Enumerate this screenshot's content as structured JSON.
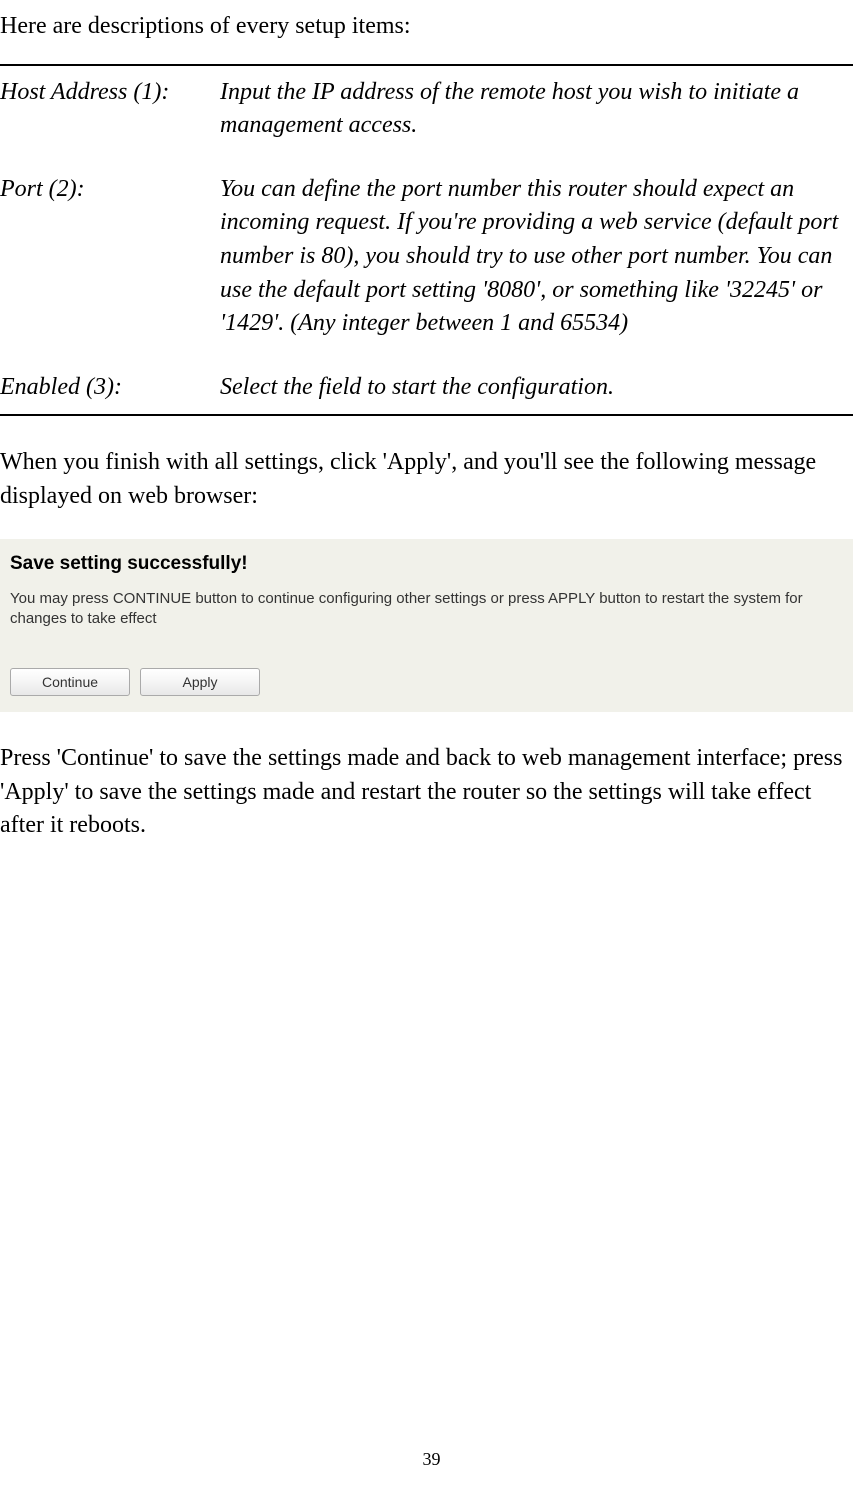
{
  "intro": "Here are descriptions of every setup items:",
  "definitions": [
    {
      "label": "Host Address (1):",
      "desc": "Input the IP address of the remote host you wish to initiate a management access."
    },
    {
      "label": "Port (2):",
      "desc": "You can define the port number this router should expect an incoming request. If you're providing a web service (default port number is 80), you should try to use other port number. You can use the default port setting '8080', or something like '32245' or '1429'. (Any integer between 1 and 65534)"
    },
    {
      "label": "Enabled (3):",
      "desc": "Select the field to start the configuration."
    }
  ],
  "paragraph1": "When you finish with all settings, click 'Apply', and you'll see the following message displayed on web browser:",
  "dialog": {
    "title": "Save setting successfully!",
    "text": "You may press CONTINUE button to continue configuring other settings or press APPLY button to restart the system for changes to take effect",
    "continue_label": "Continue",
    "apply_label": "Apply"
  },
  "paragraph2": "Press 'Continue' to save the settings made and back to web management interface; press 'Apply' to save the settings made and restart the router so the settings will take effect after it reboots.",
  "page_number": "39"
}
